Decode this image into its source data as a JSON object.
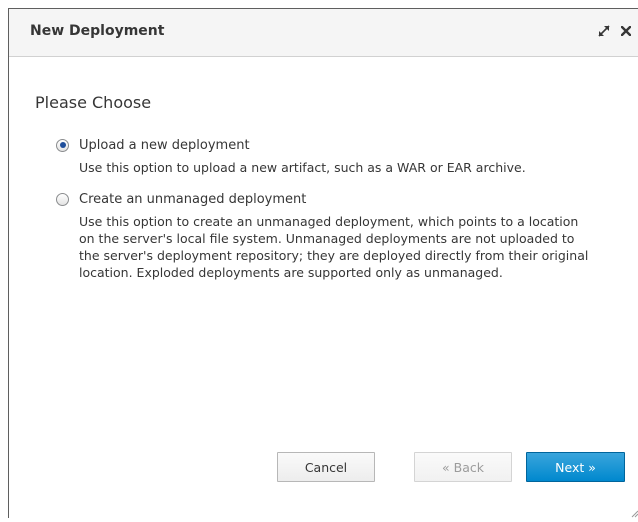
{
  "dialog": {
    "title": "New Deployment",
    "maximize_icon": "expand-arrows-icon",
    "close_icon": "close-icon"
  },
  "content": {
    "heading": "Please Choose",
    "options": [
      {
        "label": "Upload a new deployment",
        "description": "Use this option to upload a new artifact, such as a WAR or EAR archive.",
        "selected": true
      },
      {
        "label": "Create an unmanaged deployment",
        "description": "Use this option to create an unmanaged deployment, which points to a location on the server's local file system. Unmanaged deployments are not uploaded to the server's deployment repository; they are deployed directly from their original location. Exploded deployments are supported only as unmanaged.",
        "selected": false
      }
    ]
  },
  "buttons": {
    "cancel": "Cancel",
    "back": "« Back",
    "next": "Next »"
  },
  "colors": {
    "primary": "#0088ce",
    "title_bar": "#f5f5f5",
    "text": "#363636"
  }
}
